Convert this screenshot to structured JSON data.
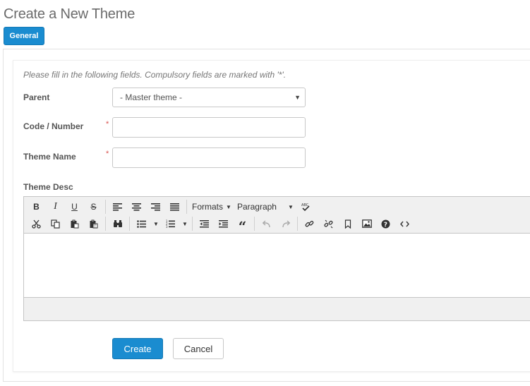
{
  "page": {
    "title": "Create a New Theme"
  },
  "tabs": [
    {
      "label": "General",
      "active": true
    }
  ],
  "form": {
    "instructions": "Please fill in the following fields. Compulsory fields are marked with '*'.",
    "required_marker": "*",
    "parent": {
      "label": "Parent",
      "value": "- Master theme -"
    },
    "code": {
      "label": "Code / Number",
      "value": ""
    },
    "name": {
      "label": "Theme Name",
      "value": ""
    },
    "desc": {
      "label": "Theme Desc"
    }
  },
  "editor": {
    "formats_label": "Formats",
    "paragraph_label": "Paragraph",
    "row1_icons": [
      "bold-icon",
      "italic-icon",
      "underline-icon",
      "strikethrough-icon",
      "align-left-icon",
      "align-center-icon",
      "align-right-icon",
      "align-justify-icon",
      "spellcheck-icon"
    ],
    "row2_icons": [
      "cut-icon",
      "copy-icon",
      "paste-icon",
      "paste-text-icon",
      "find-icon",
      "bullet-list-icon",
      "numbered-list-icon",
      "outdent-icon",
      "indent-icon",
      "blockquote-icon",
      "undo-icon",
      "redo-icon",
      "link-icon",
      "unlink-icon",
      "bookmark-icon",
      "image-icon",
      "help-icon",
      "source-code-icon"
    ]
  },
  "actions": {
    "create_label": "Create",
    "cancel_label": "Cancel"
  },
  "colors": {
    "accent": "#1a8cd0",
    "required": "#d9534f"
  }
}
